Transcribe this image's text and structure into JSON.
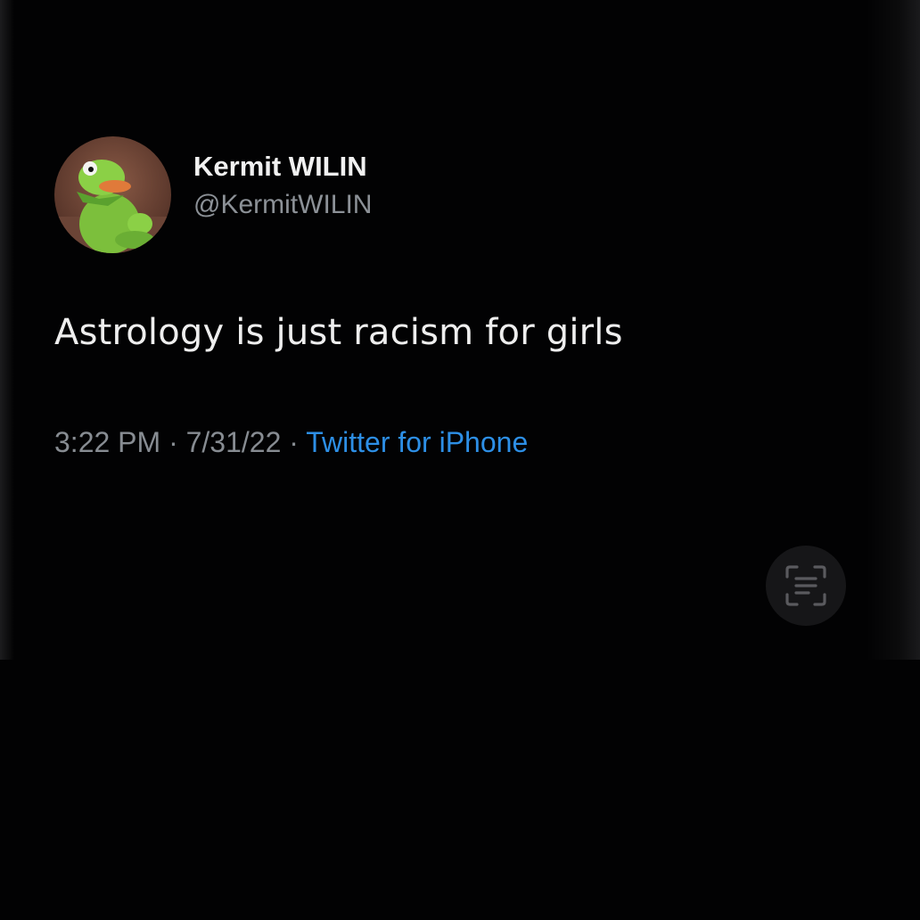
{
  "tweet": {
    "author": {
      "display_name": "Kermit WILIN",
      "handle": "@KermitWILIN",
      "avatar_icon": "kermit-avatar-icon"
    },
    "text": "Astrology is just racism for girls",
    "time": "3:22 PM",
    "separator": "·",
    "date": "7/31/22",
    "source": "Twitter for iPhone"
  },
  "overlay": {
    "scan_icon": "live-text-scan-icon"
  },
  "colors": {
    "background": "#020203",
    "name": "#f1f1f1",
    "muted": "#878c92",
    "link": "#2d8fe6"
  }
}
